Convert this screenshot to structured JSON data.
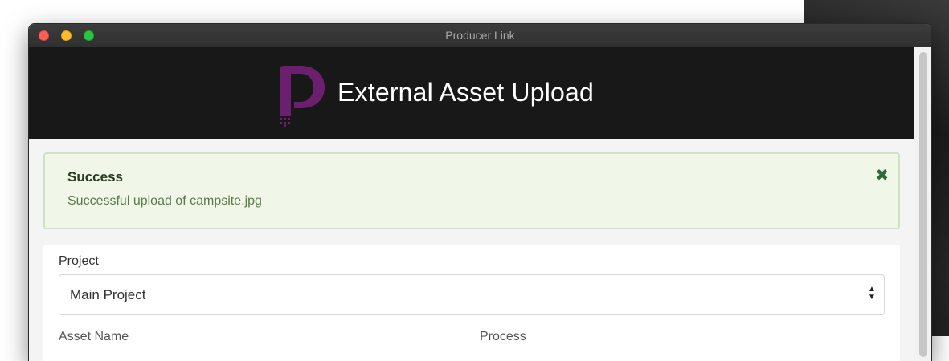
{
  "window": {
    "title": "Producer Link"
  },
  "header": {
    "title": "External Asset Upload",
    "logo_icon": "producer-link-logo",
    "brand_color": "#6b1f6e"
  },
  "alert": {
    "heading": "Success",
    "message": "Successful upload of campsite.jpg",
    "close_icon": "close-icon"
  },
  "form": {
    "project_label": "Project",
    "project_value": "Main Project",
    "asset_name_label": "Asset Name",
    "process_label": "Process"
  }
}
